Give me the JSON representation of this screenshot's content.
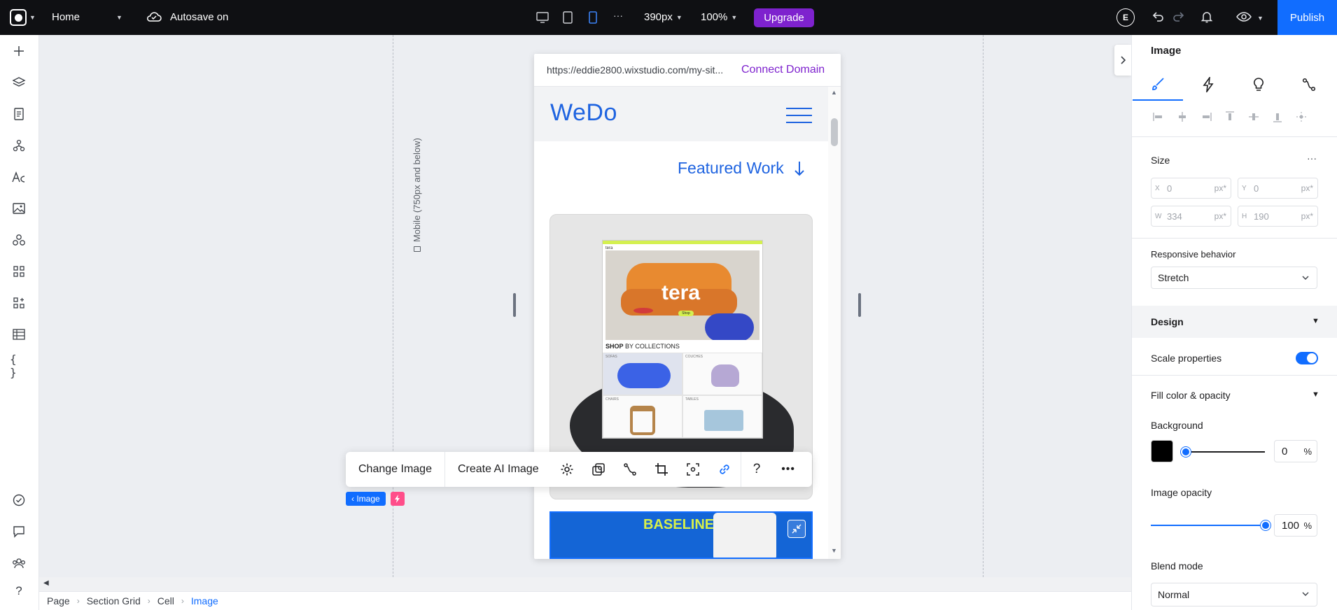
{
  "topbar": {
    "page_name": "Home",
    "autosave": "Autosave on",
    "width_value": "390px",
    "zoom_value": "100%",
    "upgrade_label": "Upgrade",
    "avatar_initial": "E",
    "publish_label": "Publish",
    "more_glyph": "···"
  },
  "canvas": {
    "breakpoint_label": "Mobile (750px and below)"
  },
  "site": {
    "url": "https://eddie2800.wixstudio.com/my-sit...",
    "connect_domain": "Connect Domain",
    "logo": "WeDo",
    "featured_work": "Featured Work",
    "mock": {
      "brand": "tera",
      "hero_text": "tera",
      "shop_btn": "Shop",
      "shop_heading_bold": "SHOP",
      "shop_heading_rest": " BY COLLECTIONS",
      "cells": [
        "SOFAS",
        "COUCHES",
        "CHAIRS",
        "TABLES"
      ]
    },
    "baseline_text": "BASELINE"
  },
  "toolbar": {
    "change_image": "Change Image",
    "create_ai_image": "Create AI Image"
  },
  "element_tag": "‹ Image",
  "breadcrumb": [
    "Page",
    "Section Grid",
    "Cell",
    "Image"
  ],
  "panel": {
    "title": "Image",
    "size_label": "Size",
    "size_menu_glyph": "···",
    "x_key": "X",
    "x_value": "0",
    "x_unit": "px*",
    "y_key": "Y",
    "y_value": "0",
    "y_unit": "px*",
    "w_key": "W",
    "w_value": "334",
    "w_unit": "px*",
    "h_key": "H",
    "h_value": "190",
    "h_unit": "px*",
    "responsive_label": "Responsive behavior",
    "responsive_value": "Stretch",
    "design_label": "Design",
    "scale_label": "Scale properties",
    "fill_label": "Fill color & opacity",
    "background_label": "Background",
    "background_color": "#000000",
    "background_opacity_value": "0",
    "background_opacity_unit": "%",
    "image_opacity_label": "Image opacity",
    "image_opacity_value": "100",
    "image_opacity_unit": "%",
    "blend_label": "Blend mode",
    "blend_value": "Normal"
  },
  "colors": {
    "accent": "#116dff",
    "upgrade": "#7e22ce",
    "site_blue": "#1e63e0"
  }
}
